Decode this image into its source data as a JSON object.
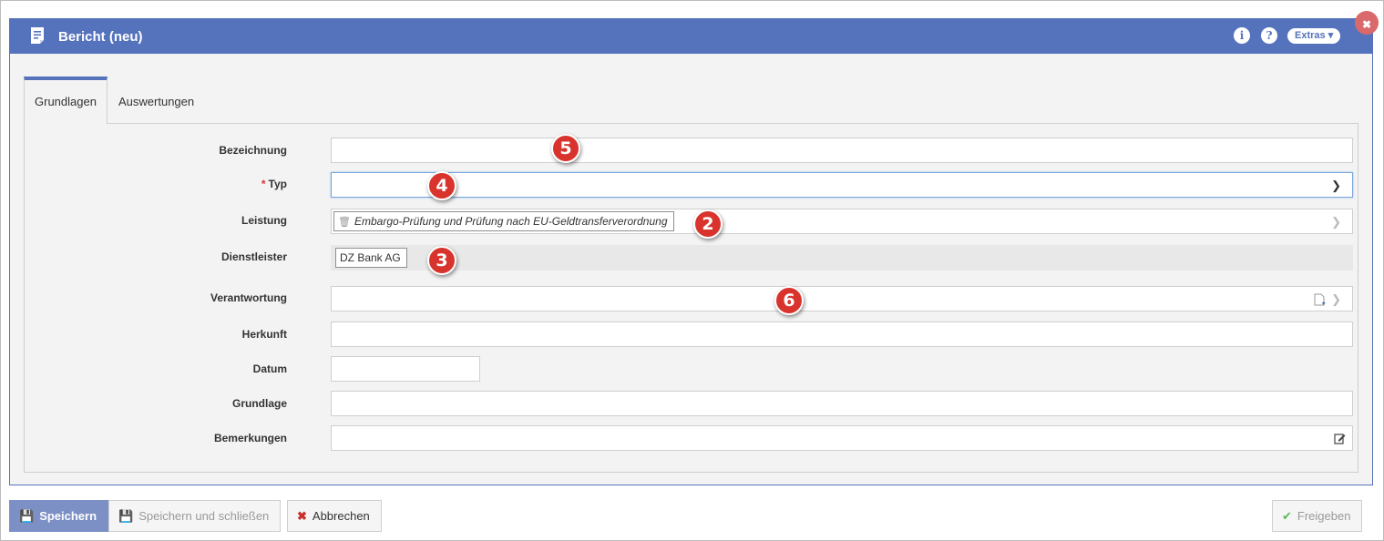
{
  "dialog": {
    "title": "Bericht (neu)",
    "info_icon": "i",
    "help_icon": "?",
    "extras_label": "Extras ▾",
    "close_label": "✖"
  },
  "tabs": [
    {
      "label": "Grundlagen",
      "active": true
    },
    {
      "label": "Auswertungen",
      "active": false
    }
  ],
  "form": {
    "bezeichnung": {
      "label": "Bezeichnung",
      "value": ""
    },
    "typ": {
      "label": "Typ",
      "required_mark": "*",
      "value": ""
    },
    "leistung": {
      "label": "Leistung",
      "value": "Embargo-Prüfung und Prüfung nach EU-Geldtransferverordnung"
    },
    "dienstleister": {
      "label": "Dienstleister",
      "value": "DZ Bank AG"
    },
    "verantwortung": {
      "label": "Verantwortung",
      "value": ""
    },
    "herkunft": {
      "label": "Herkunft",
      "value": ""
    },
    "datum": {
      "label": "Datum",
      "value": ""
    },
    "grundlage": {
      "label": "Grundlage",
      "value": ""
    },
    "bemerkungen": {
      "label": "Bemerkungen",
      "value": ""
    }
  },
  "badges": [
    "5",
    "4",
    "2",
    "3",
    "6"
  ],
  "footer": {
    "save": "Speichern",
    "save_close": "Speichern und schließen",
    "cancel": "Abbrechen",
    "release": "Freigeben"
  },
  "colors": {
    "header_bg": "#5573bd",
    "badge_bg": "#d8342d",
    "primary_button": "#7d90c6",
    "required": "#d9303a"
  }
}
